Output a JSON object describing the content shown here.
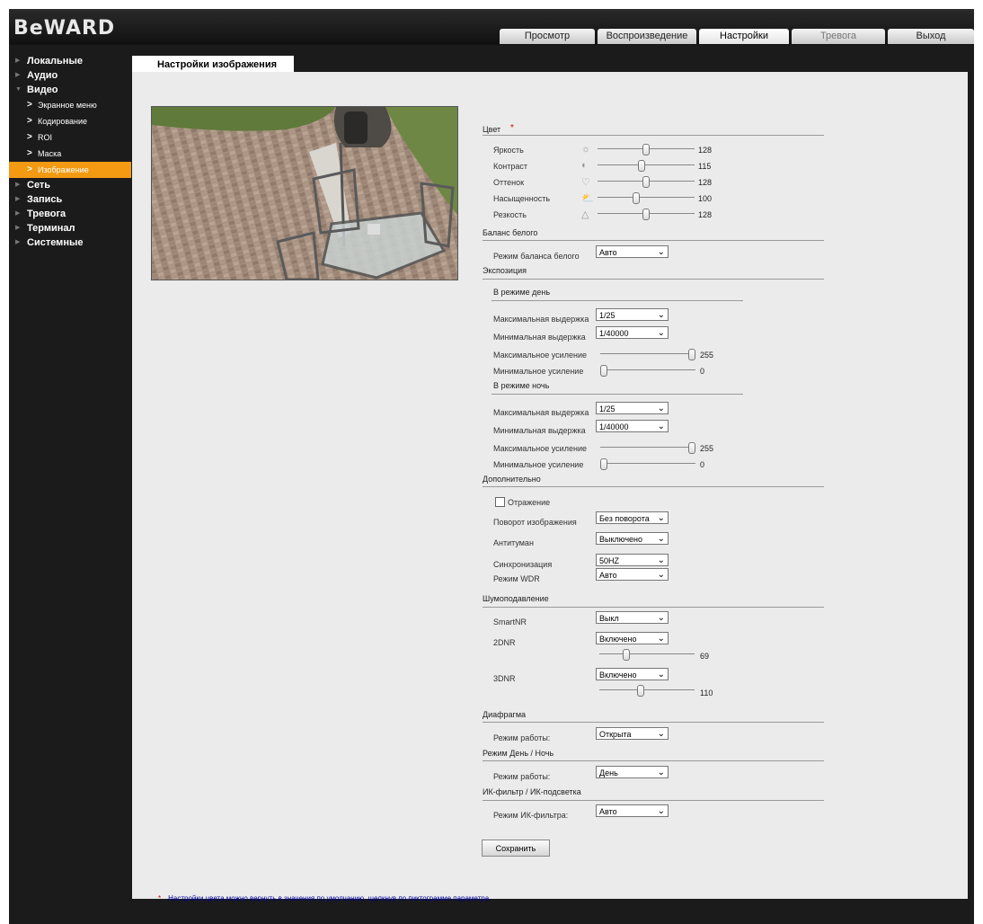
{
  "header": {
    "logo": "BeWARD",
    "tabs": [
      {
        "label": "Просмотр"
      },
      {
        "label": "Воспроизведение"
      },
      {
        "label": "Настройки"
      },
      {
        "label": "Тревога"
      },
      {
        "label": "Выход"
      }
    ],
    "active_tab": "Настройки"
  },
  "sidebar": {
    "items": [
      {
        "label": "Локальные",
        "level": 0
      },
      {
        "label": "Аудио",
        "level": 0
      },
      {
        "label": "Видео",
        "level": 0,
        "expanded": true
      },
      {
        "label": "Экранное меню",
        "level": 1
      },
      {
        "label": "Кодирование",
        "level": 1
      },
      {
        "label": "ROI",
        "level": 1
      },
      {
        "label": "Маска",
        "level": 1
      },
      {
        "label": "Изображение",
        "level": 1,
        "selected": true
      },
      {
        "label": "Сеть",
        "level": 0
      },
      {
        "label": "Запись",
        "level": 0
      },
      {
        "label": "Тревога",
        "level": 0
      },
      {
        "label": "Терминал",
        "level": 0
      },
      {
        "label": "Системные",
        "level": 0
      }
    ]
  },
  "page": {
    "title": "Настройки изображения"
  },
  "color": {
    "title": "Цвет",
    "required_mark": "*",
    "sliders": [
      {
        "label": "Яркость",
        "icon": "brightness-icon",
        "value": "128",
        "level": 0.5
      },
      {
        "label": "Контраст",
        "icon": "contrast-icon",
        "value": "115",
        "level": 0.45
      },
      {
        "label": "Оттенок",
        "icon": "hue-icon",
        "value": "128",
        "level": 0.5
      },
      {
        "label": "Насыщенность",
        "icon": "saturation-icon",
        "value": "100",
        "level": 0.39
      },
      {
        "label": "Резкость",
        "icon": "sharpness-icon",
        "value": "128",
        "level": 0.5
      }
    ]
  },
  "white_balance": {
    "title": "Баланс белого",
    "mode_label": "Режим баланса белого",
    "mode_value": "Авто"
  },
  "exposure": {
    "title": "Экспозиция",
    "day": {
      "title": "В режиме день",
      "max_shutter_label": "Максимальная выдержка",
      "max_shutter": "1/25",
      "min_shutter_label": "Минимальная выдержка",
      "min_shutter": "1/40000",
      "max_gain_label": "Максимальное усиление",
      "max_gain": "255",
      "max_gain_level": 1.0,
      "min_gain_label": "Минимальное усиление",
      "min_gain": "0",
      "min_gain_level": 0.0
    },
    "night": {
      "title": "В режиме ночь",
      "max_shutter_label": "Максимальная выдержка",
      "max_shutter": "1/25",
      "min_shutter_label": "Минимальная выдержка",
      "min_shutter": "1/40000",
      "max_gain_label": "Максимальное усиление",
      "max_gain": "255",
      "max_gain_level": 1.0,
      "min_gain_label": "Минимальное усиление",
      "min_gain": "0",
      "min_gain_level": 0.0
    }
  },
  "additional": {
    "title": "Дополнительно",
    "mirror_label": "Отражение",
    "mirror_checked": false,
    "rotation_label": "Поворот изображения",
    "rotation": "Без поворота",
    "defog_label": "Антитуман",
    "defog": "Выключено",
    "sync_label": "Синхронизация",
    "sync": "50HZ",
    "wdr_label": "Режим WDR",
    "wdr": "Авто"
  },
  "noise": {
    "title": "Шумоподавление",
    "smartnr_label": "SmartNR",
    "smartnr": "Выкл",
    "dnr2_label": "2DNR",
    "dnr2": "Включено",
    "dnr2_value": "69",
    "dnr2_level": 0.27,
    "dnr3_label": "3DNR",
    "dnr3": "Включено",
    "dnr3_value": "110",
    "dnr3_level": 0.43
  },
  "iris": {
    "title": "Диафрагма",
    "mode_label": "Режим работы:",
    "mode": "Открыта"
  },
  "daynight": {
    "title": "Режим День / Ночь",
    "mode_label": "Режим работы:",
    "mode": "День"
  },
  "ircut": {
    "title": "ИК-фильтр / ИК-подсветка",
    "mode_label": "Режим ИК-фильтра:",
    "mode": "Авто"
  },
  "save_label": "Сохранить",
  "footnote": {
    "mark": "*",
    "text": "Настройки цвета можно вернуть в значения по умолчанию, щелкнув по пиктограмме параметра."
  }
}
